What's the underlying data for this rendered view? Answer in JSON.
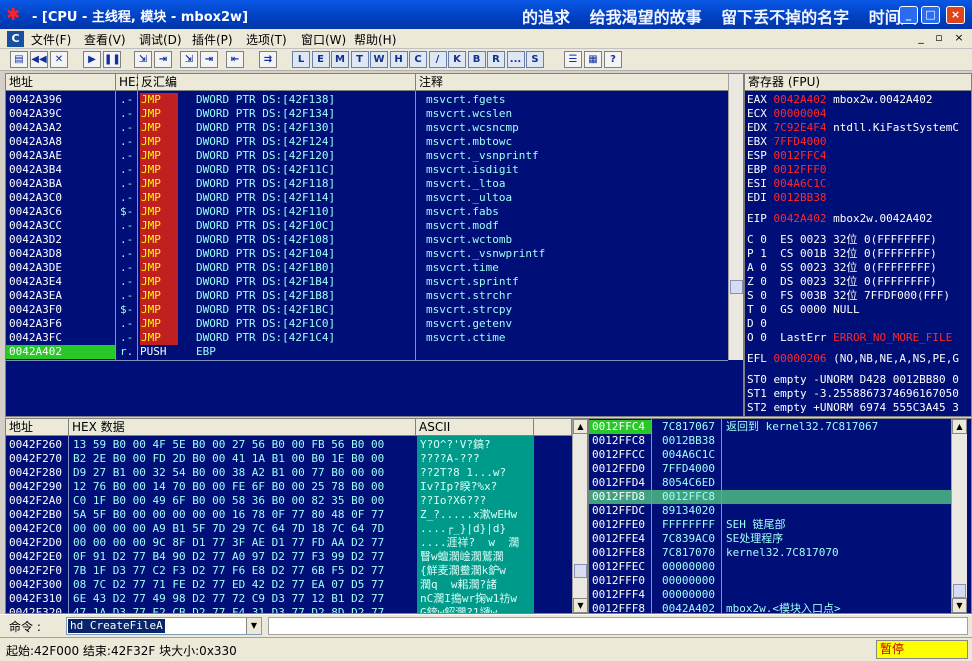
{
  "window": {
    "title": " - [CPU - 主线程, 模块 - mbox2w]",
    "banner": "的追求 给我渴望的故事 留下丢不掉的名字 时间风",
    "app_icon": "bug-icon",
    "min_label": "_",
    "max_label": "□",
    "close_label": "×"
  },
  "menubar": {
    "icon_label": "C",
    "items": [
      "文件(F)",
      "查看(V)",
      "调试(D)",
      "插件(P)",
      "选项(T)",
      "窗口(W)",
      "帮助(H)"
    ],
    "mdi_min": "_",
    "mdi_restore": "▫",
    "mdi_close": "×"
  },
  "toolbar": {
    "left_buttons": [
      "open-icon",
      "rewind-icon",
      "close-icon",
      "run-icon",
      "pause-icon",
      "step-into-icon",
      "step-over-icon",
      "trace-into-icon",
      "trace-over-icon",
      "execute-till-return-icon",
      "goto-icon"
    ],
    "letters": [
      "L",
      "E",
      "M",
      "T",
      "W",
      "H",
      "C",
      "/",
      "K",
      "B",
      "R",
      "...",
      "S"
    ],
    "right_buttons": [
      "list-icon",
      "grid-icon",
      "help-icon"
    ],
    "left_glyphs": [
      "▤",
      "◀◀",
      "✕",
      "▶",
      "❚❚",
      "⇲",
      "⇥",
      "⇲",
      "⇥",
      "⇤",
      "⇉"
    ],
    "right_glyphs": [
      "☰",
      "▦",
      "?"
    ]
  },
  "disasm": {
    "headers": {
      "address": "地址",
      "hex": "HEX",
      "disasm": "反汇编",
      "comment": "注释"
    },
    "rows": [
      {
        "addr": "0042A396",
        "mark": ".-",
        "op": "JMP",
        "args": "DWORD PTR DS:[42F138]",
        "comment": "msvcrt.fgets"
      },
      {
        "addr": "0042A39C",
        "mark": ".-",
        "op": "JMP",
        "args": "DWORD PTR DS:[42F134]",
        "comment": "msvcrt.wcslen"
      },
      {
        "addr": "0042A3A2",
        "mark": ".-",
        "op": "JMP",
        "args": "DWORD PTR DS:[42F130]",
        "comment": "msvcrt.wcsncmp"
      },
      {
        "addr": "0042A3A8",
        "mark": ".-",
        "op": "JMP",
        "args": "DWORD PTR DS:[42F124]",
        "comment": "msvcrt.mbtowc"
      },
      {
        "addr": "0042A3AE",
        "mark": ".-",
        "op": "JMP",
        "args": "DWORD PTR DS:[42F120]",
        "comment": "msvcrt._vsnprintf"
      },
      {
        "addr": "0042A3B4",
        "mark": ".-",
        "op": "JMP",
        "args": "DWORD PTR DS:[42F11C]",
        "comment": "msvcrt.isdigit"
      },
      {
        "addr": "0042A3BA",
        "mark": ".-",
        "op": "JMP",
        "args": "DWORD PTR DS:[42F118]",
        "comment": "msvcrt._ltoa"
      },
      {
        "addr": "0042A3C0",
        "mark": ".-",
        "op": "JMP",
        "args": "DWORD PTR DS:[42F114]",
        "comment": "msvcrt._ultoa"
      },
      {
        "addr": "0042A3C6",
        "mark": "$-",
        "op": "JMP",
        "args": "DWORD PTR DS:[42F110]",
        "comment": "msvcrt.fabs"
      },
      {
        "addr": "0042A3CC",
        "mark": ".-",
        "op": "JMP",
        "args": "DWORD PTR DS:[42F10C]",
        "comment": "msvcrt.modf"
      },
      {
        "addr": "0042A3D2",
        "mark": ".-",
        "op": "JMP",
        "args": "DWORD PTR DS:[42F108]",
        "comment": "msvcrt.wctomb"
      },
      {
        "addr": "0042A3D8",
        "mark": ".-",
        "op": "JMP",
        "args": "DWORD PTR DS:[42F104]",
        "comment": "msvcrt._vsnwprintf"
      },
      {
        "addr": "0042A3DE",
        "mark": ".-",
        "op": "JMP",
        "args": "DWORD PTR DS:[42F1B0]",
        "comment": "msvcrt.time"
      },
      {
        "addr": "0042A3E4",
        "mark": ".-",
        "op": "JMP",
        "args": "DWORD PTR DS:[42F1B4]",
        "comment": "msvcrt.sprintf"
      },
      {
        "addr": "0042A3EA",
        "mark": ".-",
        "op": "JMP",
        "args": "DWORD PTR DS:[42F1B8]",
        "comment": "msvcrt.strchr"
      },
      {
        "addr": "0042A3F0",
        "mark": "$-",
        "op": "JMP",
        "args": "DWORD PTR DS:[42F1BC]",
        "comment": "msvcrt.strcpy"
      },
      {
        "addr": "0042A3F6",
        "mark": ".-",
        "op": "JMP",
        "args": "DWORD PTR DS:[42F1C0]",
        "comment": "msvcrt.getenv"
      },
      {
        "addr": "0042A3FC",
        "mark": ".-",
        "op": "JMP",
        "args": "DWORD PTR DS:[42F1C4]",
        "comment": "msvcrt.ctime"
      },
      {
        "addr": "0042A402",
        "mark": "r.",
        "op": "PUSH",
        "args": "EBP",
        "comment": ""
      }
    ]
  },
  "registers": {
    "header": "寄存器 (FPU)",
    "gp": [
      {
        "name": "EAX",
        "value": "0042A402",
        "note": "mbox2w.0042A402"
      },
      {
        "name": "ECX",
        "value": "00000004",
        "note": ""
      },
      {
        "name": "EDX",
        "value": "7C92E4F4",
        "note": "ntdll.KiFastSystemC"
      },
      {
        "name": "EBX",
        "value": "7FFD4000",
        "note": ""
      },
      {
        "name": "ESP",
        "value": "0012FFC4",
        "note": ""
      },
      {
        "name": "EBP",
        "value": "0012FFF0",
        "note": ""
      },
      {
        "name": "ESI",
        "value": "004A6C1C",
        "note": ""
      },
      {
        "name": "EDI",
        "value": "0012BB38",
        "note": ""
      }
    ],
    "eip": {
      "name": "EIP",
      "value": "0042A402",
      "note": "mbox2w.0042A402"
    },
    "flags": [
      "C 0  ES 0023 32位 0(FFFFFFFF)",
      "P 1  CS 001B 32位 0(FFFFFFFF)",
      "A 0  SS 0023 32位 0(FFFFFFFF)",
      "Z 0  DS 0023 32位 0(FFFFFFFF)",
      "S 0  FS 003B 32位 7FFDF000(FFF)",
      "T 0  GS 0000 NULL",
      "D 0"
    ],
    "lasterr_prefix": "O 0  LastErr ",
    "lasterr_value": "ERROR_NO_MORE_FILE",
    "efl_label": "EFL ",
    "efl_value": "00000206",
    "efl_note": " (NO,NB,NE,A,NS,PE,G",
    "fpu": [
      "ST0 empty -UNORM D428 0012BB80 0",
      "ST1 empty -3.2558867374696167050",
      "ST2 empty +UNORM 6974 555C3A45 3"
    ]
  },
  "dump": {
    "headers": {
      "address": "地址",
      "hex": "HEX 数据",
      "ascii": "ASCII"
    },
    "rows": [
      {
        "addr": "0042F260",
        "hex": "13 59 B0 00 4F 5E B0 00 27 56 B0 00 FB 56 B0 00",
        "ascii": "Y?O^?'V?鎬?"
      },
      {
        "addr": "0042F270",
        "hex": "B2 2E B0 00 FD 2D B0 00 41 1A B1 00 B0 1E B0 00",
        "ascii": "????A-???"
      },
      {
        "addr": "0042F280",
        "hex": "D9 27 B1 00 32 54 B0 00 38 A2 B1 00 77 B0 00 00",
        "ascii": "??2T?8 1...w?"
      },
      {
        "addr": "0042F290",
        "hex": "12 76 B0 00 14 70 B0 00 FE 6F B0 00 25 78 B0 00",
        "ascii": "Iv?Ip?睽?%x?"
      },
      {
        "addr": "0042F2A0",
        "hex": "C0 1F B0 00 49 6F B0 00 58 36 B0 00 82 35 B0 00",
        "ascii": "??Io?X6???"
      },
      {
        "addr": "0042F2B0",
        "hex": "5A 5F B0 00 00 00 00 00 16 78 0F 77 80 48 0F 77",
        "ascii": "Z_?.....x漱wEHw"
      },
      {
        "addr": "0042F2C0",
        "hex": "00 00 00 00 A9 B1 5F 7D 29 7C 64 7D 18 7C 64 7D",
        "ascii": "....┌_}|d}|d}"
      },
      {
        "addr": "0042F2D0",
        "hex": "00 00 00 00 9C 8F D1 77 3F AE D1 77 FD AA D2 77",
        "ascii": "....涯祥?  w  濶"
      },
      {
        "addr": "0042F2E0",
        "hex": "0F 91 D2 77 B4 90 D2 77 A0 97 D2 77 F3 99 D2 77",
        "ascii": "瞖w蟺濶崯濶鷲濶"
      },
      {
        "addr": "0042F2F0",
        "hex": "7B 1F D3 77 C2 F3 D2 77 F6 E8 D2 77 6B F5 D2 77",
        "ascii": "{觧麦濶鲞濶k鈩w"
      },
      {
        "addr": "0042F300",
        "hex": "08 7C D2 77 71 FE D2 77 ED 42 D2 77 EA 07 D5 77",
        "ascii": "濶q  w耜濶?諸"
      },
      {
        "addr": "0042F310",
        "hex": "6E 43 D2 77 49 98 D2 77 72 C9 D3 77 12 B1 D2 77",
        "ascii": "nC濶I搗wr掬w1祊w"
      },
      {
        "addr": "0042F320",
        "hex": "47 1A D3 77 E2 CB D2 77 F4 31 D3 77 D2 8D D2 77",
        "ascii": "G錛w鉊濶?1譴w"
      }
    ]
  },
  "stack": {
    "rows": [
      {
        "addr": "0012FFC4",
        "value": "7C817067",
        "note": "返回到 kernel32.7C817067",
        "state": "current"
      },
      {
        "addr": "0012FFC8",
        "value": "0012BB38",
        "note": "",
        "state": ""
      },
      {
        "addr": "0012FFCC",
        "value": "004A6C1C",
        "note": "",
        "state": ""
      },
      {
        "addr": "0012FFD0",
        "value": "7FFD4000",
        "note": "",
        "state": ""
      },
      {
        "addr": "0012FFD4",
        "value": "8054C6ED",
        "note": "",
        "state": ""
      },
      {
        "addr": "0012FFD8",
        "value": "0012FFC8",
        "note": "",
        "state": "selected"
      },
      {
        "addr": "0012FFDC",
        "value": "89134020",
        "note": "",
        "state": ""
      },
      {
        "addr": "0012FFE0",
        "value": "FFFFFFFF",
        "note": "SEH 链尾部",
        "state": ""
      },
      {
        "addr": "0012FFE4",
        "value": "7C839AC0",
        "note": "SE处理程序",
        "state": ""
      },
      {
        "addr": "0012FFE8",
        "value": "7C817070",
        "note": "kernel32.7C817070",
        "state": ""
      },
      {
        "addr": "0012FFEC",
        "value": "00000000",
        "note": "",
        "state": ""
      },
      {
        "addr": "0012FFF0",
        "value": "00000000",
        "note": "",
        "state": ""
      },
      {
        "addr": "0012FFF4",
        "value": "00000000",
        "note": "",
        "state": ""
      },
      {
        "addr": "0012FFF8",
        "value": "0042A402",
        "note": "mbox2w.<模块入口点>",
        "state": ""
      }
    ]
  },
  "command": {
    "label": "命令 :",
    "value": "hd CreateFileA",
    "dropdown": "▼"
  },
  "status": {
    "text": "起始:42F000 结束:42F32F 块大小:0x330",
    "state": "暂停"
  },
  "scroll": {
    "up": "▲",
    "down": "▼"
  },
  "colors": {
    "navy": "#000e78",
    "selection_green": "#28c828",
    "register_changed": "#ff2828",
    "jmp": "#ffff00",
    "ascii_bg": "#009a8a"
  }
}
